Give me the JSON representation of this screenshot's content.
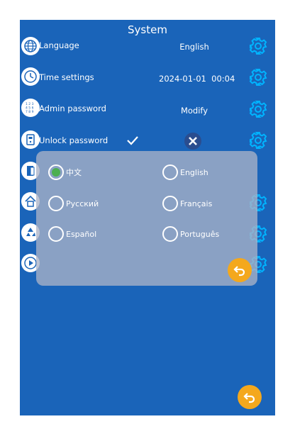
{
  "screen": {
    "title": "System"
  },
  "rows": [
    {
      "label": "Language",
      "value": "English",
      "icon": "globe-icon"
    },
    {
      "label": "Time settings",
      "value": "2024-01-01  00:04",
      "icon": "clock-icon"
    },
    {
      "label": "Admin password",
      "value": "Modify",
      "icon": "keypad-icon"
    },
    {
      "label": "Unlock password",
      "value": "",
      "icon": "door-lock-icon"
    }
  ],
  "language_dialog": {
    "options": [
      "中文",
      "English",
      "Русский",
      "Français",
      "Español",
      "Português"
    ],
    "selected": "中文"
  },
  "colors": {
    "background": "#1a64b9",
    "accent": "#f4a81d",
    "selected": "#4caf50"
  }
}
